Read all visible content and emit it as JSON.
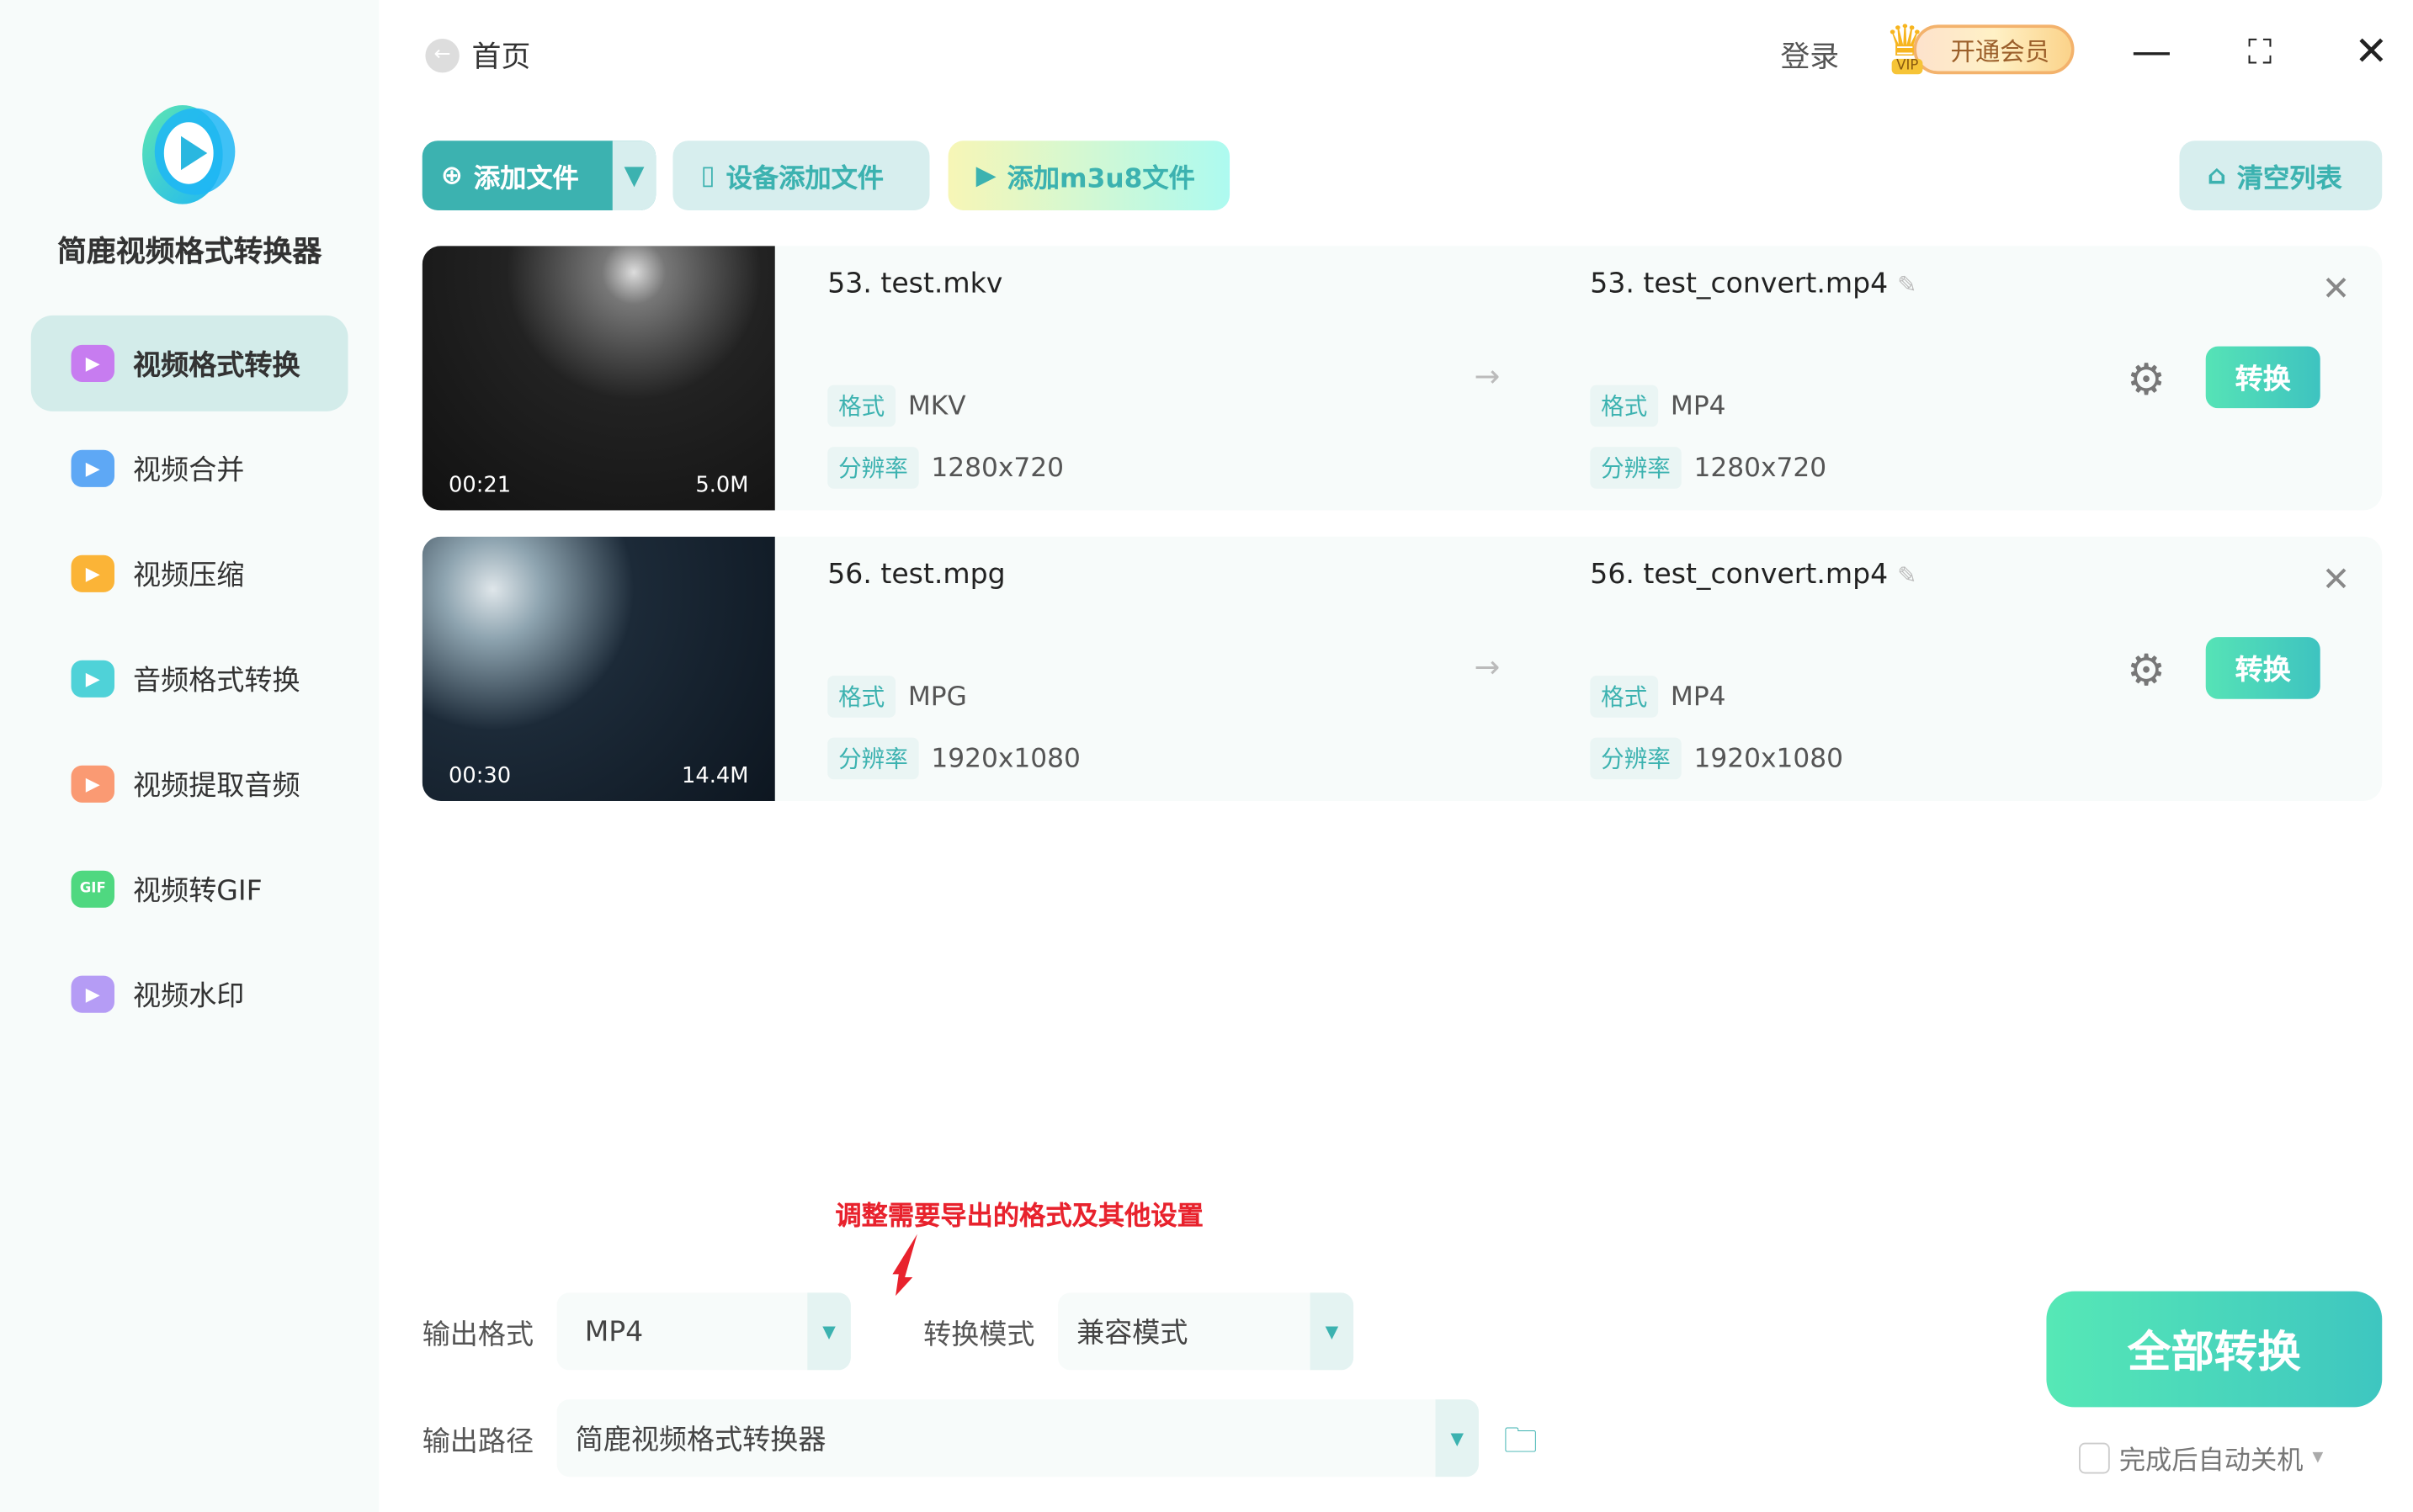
{
  "app": {
    "name": "简鹿视频格式转换器"
  },
  "sidebar": {
    "items": [
      {
        "label": "视频格式转换",
        "icon": "convert-icon",
        "color": "#c77cf0"
      },
      {
        "label": "视频合并",
        "icon": "merge-icon",
        "color": "#5ea8f5"
      },
      {
        "label": "视频压缩",
        "icon": "compress-icon",
        "color": "#fbb437"
      },
      {
        "label": "音频格式转换",
        "icon": "audio-icon",
        "color": "#4fd2d8"
      },
      {
        "label": "视频提取音频",
        "icon": "extract-audio-icon",
        "color": "#fa9a73"
      },
      {
        "label": "视频转GIF",
        "icon": "gif-icon",
        "color": "#4fd880",
        "badge": "GIF"
      },
      {
        "label": "视频水印",
        "icon": "watermark-icon",
        "color": "#b59cf5"
      }
    ]
  },
  "header": {
    "home": "首页",
    "login": "登录",
    "vip": "开通会员",
    "vip_tag": "VIP"
  },
  "toolbar": {
    "add_file": "添加文件",
    "device_add": "设备添加文件",
    "add_m3u8": "添加m3u8文件",
    "clear_list": "清空列表"
  },
  "labels": {
    "format": "格式",
    "resolution": "分辨率",
    "convert": "转换"
  },
  "files": [
    {
      "src_name": "53. test.mkv",
      "src_format": "MKV",
      "src_res": "1280x720",
      "dst_name": "53. test_convert.mp4",
      "dst_format": "MP4",
      "dst_res": "1280x720",
      "duration": "00:21",
      "size": "5.0M"
    },
    {
      "src_name": "56. test.mpg",
      "src_format": "MPG",
      "src_res": "1920x1080",
      "dst_name": "56. test_convert.mp4",
      "dst_format": "MP4",
      "dst_res": "1920x1080",
      "duration": "00:30",
      "size": "14.4M"
    }
  ],
  "annotation": "调整需要导出的格式及其他设置",
  "bottom": {
    "output_format_label": "输出格式",
    "output_format": "MP4",
    "mode_label": "转换模式",
    "mode": "兼容模式",
    "path_label": "输出路径",
    "path": "简鹿视频格式转换器",
    "convert_all": "全部转换",
    "shutdown": "完成后自动关机"
  }
}
